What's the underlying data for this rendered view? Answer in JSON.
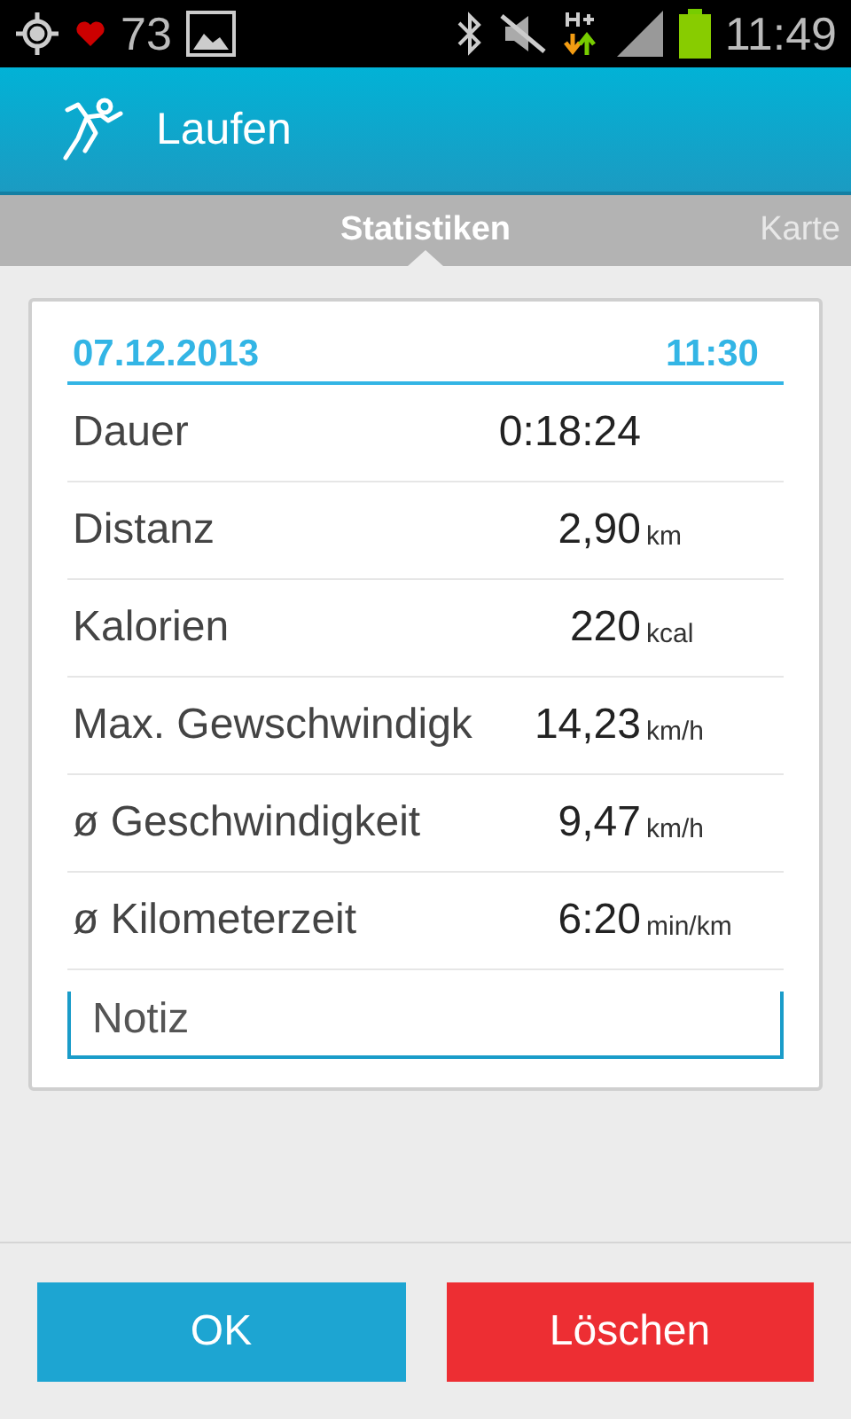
{
  "status_bar": {
    "notification_count": "73",
    "time": "11:49"
  },
  "action_bar": {
    "title": "Laufen"
  },
  "tabs": [
    {
      "label": "Statistiken",
      "selected": true
    },
    {
      "label": "Karte",
      "selected": false
    }
  ],
  "card": {
    "date": "07.12.2013",
    "time": "11:30",
    "rows": [
      {
        "label": "Dauer",
        "value": "0:18:24"
      },
      {
        "label": "Distanz",
        "value": "2,90",
        "unit": "km"
      },
      {
        "label": "Kalorien",
        "value": "220",
        "unit": "kcal"
      },
      {
        "label": "Max. Gewschwindigk",
        "value": "14,23",
        "unit": "km/h"
      },
      {
        "label": "ø Geschwindigkeit",
        "value": "9,47",
        "unit": "km/h"
      },
      {
        "label": "ø Kilometerzeit",
        "value": "6:20",
        "unit": "min/km"
      }
    ],
    "note": {
      "placeholder": "Notiz"
    }
  },
  "buttons": [
    {
      "label": "OK",
      "kind": "primary"
    },
    {
      "label": "Löschen",
      "kind": "danger"
    }
  ]
}
